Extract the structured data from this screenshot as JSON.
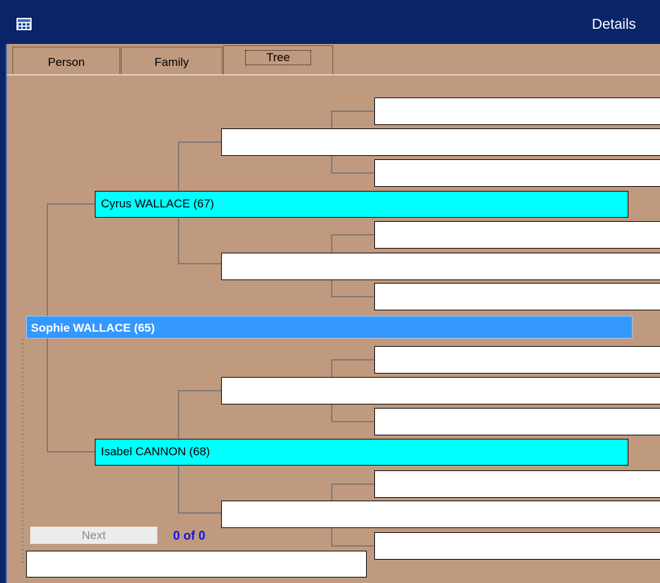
{
  "window": {
    "title": "Details"
  },
  "tabs": [
    {
      "label": "Person",
      "active": false
    },
    {
      "label": "Family",
      "active": false
    },
    {
      "label": "Tree",
      "active": true
    }
  ],
  "tree": {
    "focus": {
      "name": "Sophie WALLACE (65)"
    },
    "father": {
      "name": "Cyrus WALLACE (67)"
    },
    "mother": {
      "name": "Isabel CANNON (68)"
    },
    "paternal_grandparents": [
      "",
      ""
    ],
    "maternal_grandparents": [
      "",
      ""
    ],
    "great_grandparents": [
      "",
      "",
      "",
      "",
      "",
      "",
      "",
      ""
    ]
  },
  "pager": {
    "next_label": "Next",
    "count": "0 of 0"
  },
  "bottom_field": {
    "value": ""
  },
  "colors": {
    "titlebar": "#0a246a",
    "background": "#c09a7f",
    "parent_box": "#00ffff",
    "focus_box": "#3399ff",
    "count_text": "#1414e8"
  }
}
